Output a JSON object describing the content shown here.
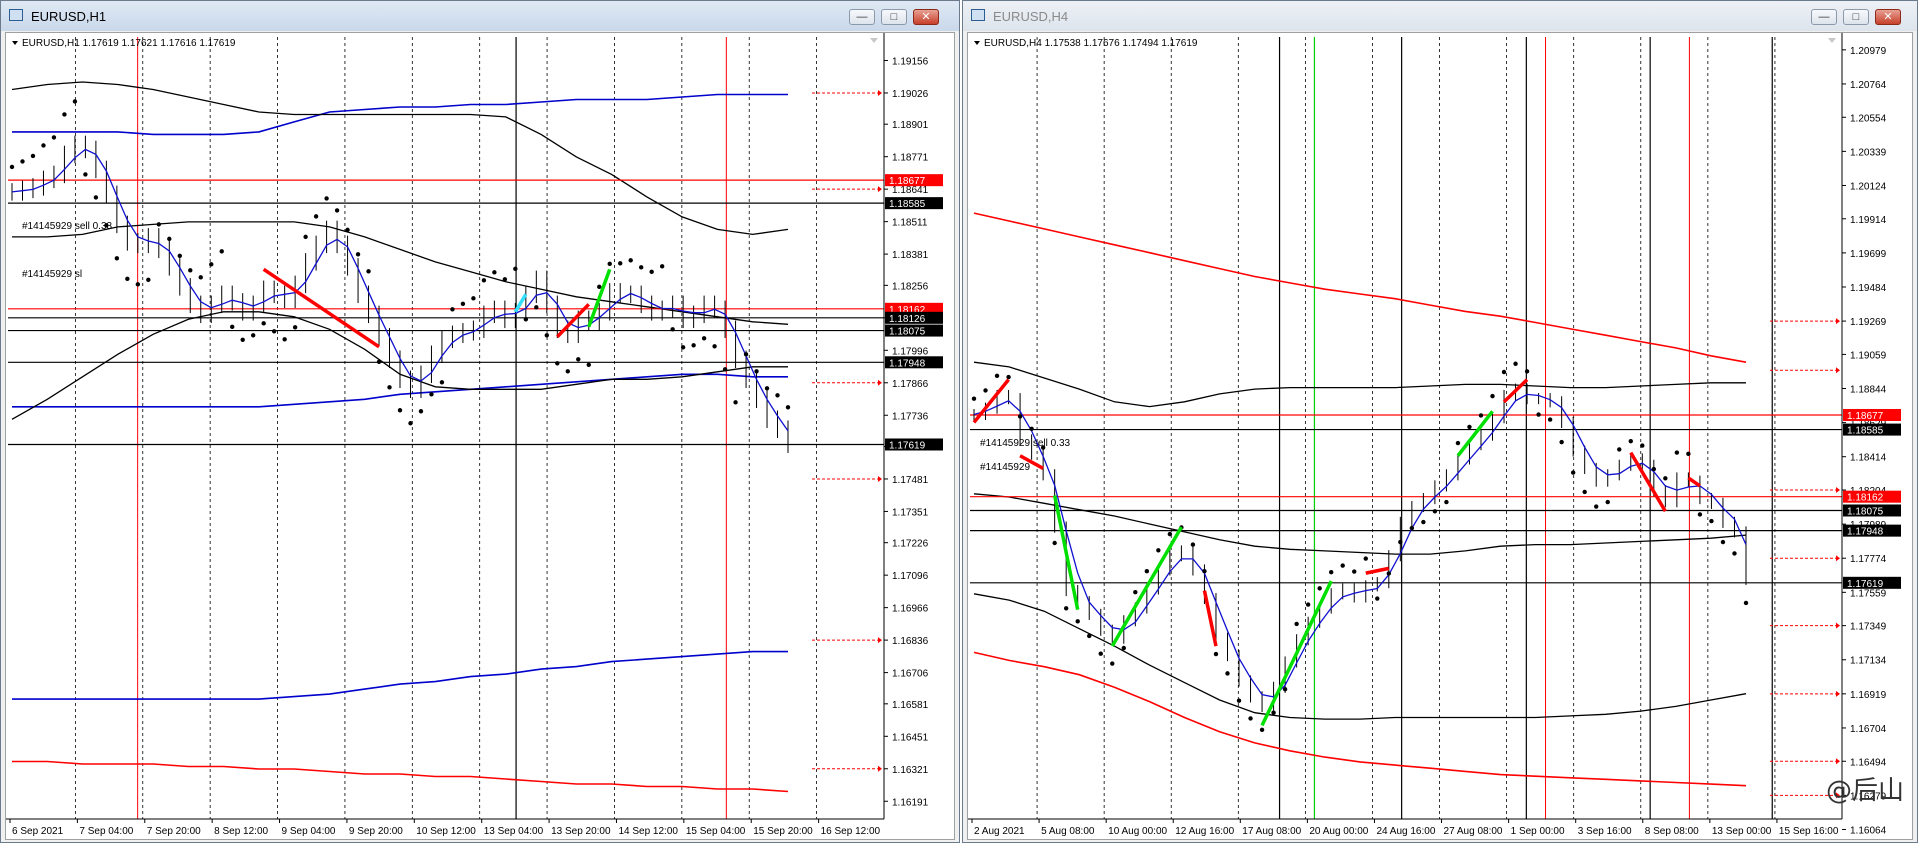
{
  "windows": [
    {
      "title": "EURUSD,H1",
      "active": true,
      "header": "EURUSD,H1  1.17619 1.17621 1.17616 1.17619",
      "buttons": {
        "minimize": "—",
        "maximize": "□",
        "close": "✕"
      },
      "orders": [
        "#14145929 sell 0.33",
        "#14145929 sl"
      ],
      "chart_data": {
        "type": "line",
        "symbol": "EURUSD",
        "timeframe": "H1",
        "ohlc": {
          "open": 1.17619,
          "high": 1.17621,
          "low": 1.17616,
          "close": 1.17619
        },
        "ylim": [
          1.1612,
          1.1925
        ],
        "y_ticks": [
          1.19156,
          1.19026,
          1.18901,
          1.18771,
          1.18641,
          1.18511,
          1.18381,
          1.18256,
          1.18126,
          1.17996,
          1.17866,
          1.17736,
          1.17611,
          1.17481,
          1.17351,
          1.17226,
          1.17096,
          1.16966,
          1.16836,
          1.16706,
          1.16581,
          1.16451,
          1.16321,
          1.16191
        ],
        "x_ticks": [
          "6 Sep 2021",
          "7 Sep 04:00",
          "7 Sep 20:00",
          "8 Sep 12:00",
          "9 Sep 04:00",
          "9 Sep 20:00",
          "10 Sep 12:00",
          "13 Sep 04:00",
          "13 Sep 20:00",
          "14 Sep 12:00",
          "15 Sep 04:00",
          "15 Sep 20:00",
          "16 Sep 12:00"
        ],
        "n": 82,
        "price": [
          1.1863,
          1.1864,
          1.1865,
          1.1868,
          1.187,
          1.1878,
          1.1882,
          1.188,
          1.1872,
          1.1862,
          1.185,
          1.1843,
          1.1842,
          1.1845,
          1.184,
          1.1833,
          1.1825,
          1.1818,
          1.1814,
          1.1818,
          1.1822,
          1.1819,
          1.1815,
          1.1818,
          1.1824,
          1.1822,
          1.182,
          1.1826,
          1.1835,
          1.1842,
          1.1848,
          1.1842,
          1.1833,
          1.1822,
          1.1814,
          1.1805,
          1.1796,
          1.1788,
          1.1784,
          1.179,
          1.1798,
          1.1804,
          1.1806,
          1.1807,
          1.1808,
          1.1814,
          1.1816,
          1.1812,
          1.1815,
          1.1822,
          1.1828,
          1.1818,
          1.1808,
          1.1806,
          1.1812,
          1.1811,
          1.1815,
          1.1823,
          1.1822,
          1.1822,
          1.1818,
          1.1815,
          1.1816,
          1.1818,
          1.1812,
          1.1814,
          1.1818,
          1.1816,
          1.1808,
          1.1796,
          1.1788,
          1.178,
          1.1772,
          1.1768,
          1.1762
        ],
        "bands_black_upper": [
          1.1904,
          1.1906,
          1.1907,
          1.1906,
          1.1904,
          1.1901,
          1.1898,
          1.1895,
          1.1894,
          1.1894,
          1.1894,
          1.1894,
          1.1894,
          1.1894,
          1.1893,
          1.1886,
          1.1877,
          1.187,
          1.1861,
          1.1853,
          1.1848,
          1.1846,
          1.1848
        ],
        "bands_black_mid": [
          1.1845,
          1.1845,
          1.1846,
          1.1849,
          1.185,
          1.1851,
          1.1851,
          1.1851,
          1.1851,
          1.1849,
          1.1845,
          1.184,
          1.1835,
          1.1831,
          1.1827,
          1.1824,
          1.1821,
          1.1819,
          1.1817,
          1.1815,
          1.1813,
          1.1811,
          1.181
        ],
        "bands_black_lower": [
          1.1772,
          1.178,
          1.1789,
          1.1798,
          1.1806,
          1.1812,
          1.1815,
          1.1815,
          1.1813,
          1.1808,
          1.18,
          1.179,
          1.1785,
          1.1784,
          1.1784,
          1.1784,
          1.1786,
          1.1788,
          1.1788,
          1.1789,
          1.1791,
          1.1793,
          1.1793
        ],
        "bands_blue_upper": [
          1.1887,
          1.1887,
          1.1887,
          1.1887,
          1.1886,
          1.1886,
          1.1886,
          1.1887,
          1.1891,
          1.1895,
          1.1896,
          1.1897,
          1.1897,
          1.1898,
          1.1898,
          1.1899,
          1.19,
          1.19,
          1.19,
          1.1901,
          1.1902,
          1.1902,
          1.1902
        ],
        "bands_blue_lower": [
          1.1777,
          1.1777,
          1.1777,
          1.1777,
          1.1777,
          1.1777,
          1.1777,
          1.1777,
          1.1778,
          1.1779,
          1.178,
          1.1782,
          1.1783,
          1.1784,
          1.1785,
          1.1786,
          1.1787,
          1.1788,
          1.1789,
          1.179,
          1.179,
          1.1789,
          1.1789
        ],
        "bands_blue_bottom": [
          1.166,
          1.166,
          1.166,
          1.166,
          1.166,
          1.166,
          1.166,
          1.166,
          1.1661,
          1.1662,
          1.1664,
          1.1666,
          1.1667,
          1.1669,
          1.167,
          1.1672,
          1.1673,
          1.1675,
          1.1676,
          1.1677,
          1.1678,
          1.1679,
          1.1679
        ],
        "bands_red_bottom": [
          1.1635,
          1.1635,
          1.1634,
          1.1634,
          1.1634,
          1.1633,
          1.1633,
          1.1632,
          1.1632,
          1.1631,
          1.163,
          1.163,
          1.1629,
          1.1629,
          1.1628,
          1.1627,
          1.1626,
          1.1626,
          1.1625,
          1.1625,
          1.1624,
          1.1624,
          1.1623
        ],
        "hlines": [
          {
            "price": 1.18677,
            "label": "1.18677",
            "color": "#ff0000"
          },
          {
            "price": 1.18585,
            "label": "1.18585",
            "color": "#000000"
          },
          {
            "price": 1.18162,
            "label": "1.18162",
            "color": "#ff0000"
          },
          {
            "price": 1.18126,
            "label": "1.18126",
            "color": "#000000"
          },
          {
            "price": 1.18075,
            "label": "1.18075",
            "color": "#000000"
          },
          {
            "price": 1.17948,
            "label": "1.17948",
            "color": "#000000"
          },
          {
            "price": 1.17619,
            "label": "1.17619",
            "color": "#000000"
          }
        ],
        "markers": [
          1.19026,
          1.18641,
          1.17866,
          1.17481,
          1.16836,
          1.16321
        ]
      }
    },
    {
      "title": "EURUSD,H4",
      "active": false,
      "header": "EURUSD,H4  1.17538 1.17676 1.17494 1.17619",
      "buttons": {
        "minimize": "—",
        "maximize": "□",
        "close": "✕"
      },
      "orders": [
        "#14145929 sell 0.33",
        "#14145929"
      ],
      "chart_data": {
        "type": "line",
        "symbol": "EURUSD",
        "timeframe": "H4",
        "ohlc": {
          "open": 1.17538,
          "high": 1.17676,
          "low": 1.17494,
          "close": 1.17619
        },
        "ylim": [
          1.1613,
          1.2106
        ],
        "y_ticks": [
          1.20979,
          1.20764,
          1.20554,
          1.20339,
          1.20124,
          1.19914,
          1.19699,
          1.19484,
          1.19269,
          1.19059,
          1.18844,
          1.18629,
          1.18414,
          1.18204,
          1.17989,
          1.17774,
          1.17559,
          1.17349,
          1.17134,
          1.16919,
          1.16704,
          1.16494,
          1.16279,
          1.16064
        ],
        "x_ticks": [
          "2 Aug 2021",
          "5 Aug 08:00",
          "10 Aug 00:00",
          "12 Aug 16:00",
          "17 Aug 08:00",
          "20 Aug 00:00",
          "24 Aug 16:00",
          "27 Aug 08:00",
          "1 Sep 00:00",
          "3 Sep 16:00",
          "8 Sep 08:00",
          "13 Sep 00:00",
          "15 Sep 16:00"
        ],
        "price": [
          1.1868,
          1.1872,
          1.188,
          1.1878,
          1.1852,
          1.1843,
          1.183,
          1.1797,
          1.1757,
          1.175,
          1.1742,
          1.1732,
          1.1727,
          1.1738,
          1.1746,
          1.1758,
          1.177,
          1.1779,
          1.1782,
          1.177,
          1.1752,
          1.1727,
          1.1716,
          1.17,
          1.169,
          1.1684,
          1.1696,
          1.1712,
          1.1726,
          1.1737,
          1.1746,
          1.1755,
          1.1758,
          1.1753,
          1.176,
          1.1762,
          1.1779,
          1.18,
          1.181,
          1.1815,
          1.1823,
          1.183,
          1.184,
          1.1849,
          1.1855,
          1.1866,
          1.188,
          1.1884,
          1.1878,
          1.1878,
          1.1876,
          1.1863,
          1.1845,
          1.1834,
          1.1826,
          1.183,
          1.1836,
          1.184,
          1.1836,
          1.182,
          1.1813,
          1.1828,
          1.1826,
          1.1815,
          1.1812,
          1.18,
          1.1794,
          1.1764
        ],
        "bands_black_upper": [
          1.1901,
          1.1898,
          1.1891,
          1.1884,
          1.1876,
          1.1873,
          1.1876,
          1.1881,
          1.1884,
          1.1885,
          1.1885,
          1.1885,
          1.1885,
          1.1886,
          1.1887,
          1.1887,
          1.1886,
          1.1885,
          1.1885,
          1.1886,
          1.1887,
          1.1888,
          1.1888
        ],
        "bands_black_mid": [
          1.1818,
          1.1816,
          1.1812,
          1.1808,
          1.1804,
          1.1799,
          1.1794,
          1.1789,
          1.1785,
          1.1783,
          1.1782,
          1.1781,
          1.178,
          1.178,
          1.1782,
          1.1785,
          1.1786,
          1.1786,
          1.1787,
          1.1788,
          1.1789,
          1.179,
          1.1792
        ],
        "bands_black_lower": [
          1.1755,
          1.1751,
          1.1744,
          1.1733,
          1.1722,
          1.171,
          1.1699,
          1.1688,
          1.168,
          1.1677,
          1.1676,
          1.1676,
          1.1677,
          1.1677,
          1.1677,
          1.1677,
          1.1677,
          1.1678,
          1.1679,
          1.1681,
          1.1684,
          1.1688,
          1.1692
        ],
        "bands_red_upper": [
          1.1995,
          1.199,
          1.1985,
          1.198,
          1.1975,
          1.197,
          1.1965,
          1.196,
          1.1955,
          1.1951,
          1.1947,
          1.1944,
          1.1941,
          1.1937,
          1.1933,
          1.193,
          1.1926,
          1.1922,
          1.1918,
          1.1914,
          1.191,
          1.1905,
          1.1901
        ],
        "bands_red_lower": [
          1.1718,
          1.1713,
          1.1709,
          1.1704,
          1.1696,
          1.1687,
          1.1677,
          1.1668,
          1.1661,
          1.1656,
          1.1652,
          1.1649,
          1.1647,
          1.1645,
          1.1643,
          1.1641,
          1.164,
          1.1639,
          1.1638,
          1.1637,
          1.1636,
          1.1635,
          1.1634
        ],
        "hlines": [
          {
            "price": 1.18677,
            "label": "1.18677",
            "color": "#ff0000"
          },
          {
            "price": 1.18585,
            "label": "1.18585",
            "color": "#000000"
          },
          {
            "price": 1.18162,
            "label": "1.18162",
            "color": "#ff0000"
          },
          {
            "price": 1.18075,
            "label": "1.18075",
            "color": "#000000"
          },
          {
            "price": 1.17948,
            "label": "1.17948",
            "color": "#000000"
          },
          {
            "price": 1.17619,
            "label": "1.17619",
            "color": "#000000"
          }
        ],
        "markers": [
          1.19269,
          1.18959,
          1.18204,
          1.17774,
          1.17349,
          1.16919,
          1.16494,
          1.16279
        ]
      }
    }
  ],
  "watermark": "@后山"
}
